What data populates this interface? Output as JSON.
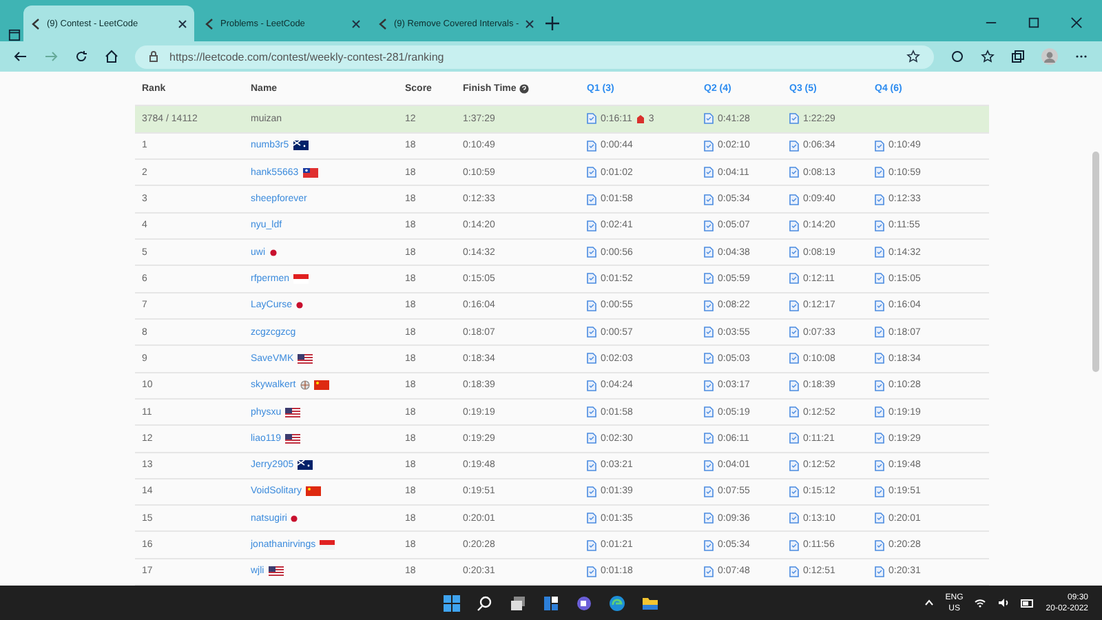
{
  "browser": {
    "tabs": [
      {
        "title": "(9) Contest - LeetCode",
        "selected": true
      },
      {
        "title": "Problems - LeetCode",
        "selected": false
      },
      {
        "title": "(9) Remove Covered Intervals -",
        "selected": false
      }
    ],
    "url": "https://leetcode.com/contest/weekly-contest-281/ranking"
  },
  "table": {
    "columns": [
      {
        "label": "Rank",
        "kind": "plain"
      },
      {
        "label": "Name",
        "kind": "plain"
      },
      {
        "label": "Score",
        "kind": "plain"
      },
      {
        "label": "Finish Time",
        "kind": "help"
      },
      {
        "label": "Q1 (3)",
        "kind": "question"
      },
      {
        "label": "Q2 (4)",
        "kind": "question"
      },
      {
        "label": "Q3 (5)",
        "kind": "question"
      },
      {
        "label": "Q4 (6)",
        "kind": "question"
      }
    ],
    "current_user": {
      "rank": "3784 / 14112",
      "name": "muizan",
      "score": "12",
      "finish": "1:37:29",
      "questions": [
        {
          "time": "0:16:11",
          "wrong": "3"
        },
        {
          "time": "0:41:28"
        },
        {
          "time": "1:22:29"
        }
      ]
    },
    "rows": [
      {
        "rank": "1",
        "name": "numb3r5",
        "flags": [
          {
            "kind": "au"
          }
        ],
        "score": "18",
        "finish": "0:10:49",
        "questions": [
          "0:00:44",
          "0:02:10",
          "0:06:34",
          "0:10:49"
        ]
      },
      {
        "rank": "2",
        "name": "hank55663",
        "flags": [
          {
            "kind": "tw"
          }
        ],
        "score": "18",
        "finish": "0:10:59",
        "questions": [
          "0:01:02",
          "0:04:11",
          "0:08:13",
          "0:10:59"
        ]
      },
      {
        "rank": "3",
        "name": "sheepforever",
        "score": "18",
        "finish": "0:12:33",
        "questions": [
          "0:01:58",
          "0:05:34",
          "0:09:40",
          "0:12:33"
        ]
      },
      {
        "rank": "4",
        "name": "nyu_ldf",
        "score": "18",
        "finish": "0:14:20",
        "questions": [
          "0:02:41",
          "0:05:07",
          "0:14:20",
          "0:11:55"
        ]
      },
      {
        "rank": "5",
        "name": "uwi",
        "flags": [
          {
            "kind": "jp"
          }
        ],
        "score": "18",
        "finish": "0:14:32",
        "questions": [
          "0:00:56",
          "0:04:38",
          "0:08:19",
          "0:14:32"
        ]
      },
      {
        "rank": "6",
        "name": "rfpermen",
        "flags": [
          {
            "kind": "id"
          }
        ],
        "score": "18",
        "finish": "0:15:05",
        "questions": [
          "0:01:52",
          "0:05:59",
          "0:12:11",
          "0:15:05"
        ]
      },
      {
        "rank": "7",
        "name": "LayCurse",
        "flags": [
          {
            "kind": "jp"
          }
        ],
        "score": "18",
        "finish": "0:16:04",
        "questions": [
          "0:00:55",
          "0:08:22",
          "0:12:17",
          "0:16:04"
        ]
      },
      {
        "rank": "8",
        "name": "zcgzcgzcg",
        "score": "18",
        "finish": "0:18:07",
        "questions": [
          "0:00:57",
          "0:03:55",
          "0:07:33",
          "0:18:07"
        ]
      },
      {
        "rank": "9",
        "name": "SaveVMK",
        "flags": [
          {
            "kind": "us"
          }
        ],
        "score": "18",
        "finish": "0:18:34",
        "questions": [
          "0:02:03",
          "0:05:03",
          "0:10:08",
          "0:18:34"
        ]
      },
      {
        "rank": "10",
        "name": "skywalkert",
        "flags": [
          {
            "kind": "badge"
          },
          {
            "kind": "cn"
          }
        ],
        "score": "18",
        "finish": "0:18:39",
        "questions": [
          "0:04:24",
          "0:03:17",
          "0:18:39",
          "0:10:28"
        ]
      },
      {
        "rank": "11",
        "name": "physxu",
        "flags": [
          {
            "kind": "us"
          }
        ],
        "score": "18",
        "finish": "0:19:19",
        "questions": [
          "0:01:58",
          "0:05:19",
          "0:12:52",
          "0:19:19"
        ]
      },
      {
        "rank": "12",
        "name": "liao119",
        "flags": [
          {
            "kind": "us"
          }
        ],
        "score": "18",
        "finish": "0:19:29",
        "questions": [
          "0:02:30",
          "0:06:11",
          "0:11:21",
          "0:19:29"
        ]
      },
      {
        "rank": "13",
        "name": "Jerry2905",
        "flags": [
          {
            "kind": "au"
          }
        ],
        "score": "18",
        "finish": "0:19:48",
        "questions": [
          "0:03:21",
          "0:04:01",
          "0:12:52",
          "0:19:48"
        ]
      },
      {
        "rank": "14",
        "name": "VoidSolitary",
        "flags": [
          {
            "kind": "cn"
          }
        ],
        "score": "18",
        "finish": "0:19:51",
        "questions": [
          "0:01:39",
          "0:07:55",
          "0:15:12",
          "0:19:51"
        ]
      },
      {
        "rank": "15",
        "name": "natsugiri",
        "flags": [
          {
            "kind": "jp"
          }
        ],
        "score": "18",
        "finish": "0:20:01",
        "questions": [
          "0:01:35",
          "0:09:36",
          "0:13:10",
          "0:20:01"
        ]
      },
      {
        "rank": "16",
        "name": "jonathanirvings",
        "flags": [
          {
            "kind": "sg"
          }
        ],
        "score": "18",
        "finish": "0:20:28",
        "questions": [
          "0:01:21",
          "0:05:34",
          "0:11:56",
          "0:20:28"
        ]
      },
      {
        "rank": "17",
        "name": "wjli",
        "flags": [
          {
            "kind": "us"
          }
        ],
        "score": "18",
        "finish": "0:20:31",
        "questions": [
          "0:01:18",
          "0:07:48",
          "0:12:51",
          "0:20:31"
        ]
      }
    ]
  },
  "taskbar": {
    "language": "ENG",
    "region": "US",
    "time": "09:30",
    "date": "20-02-2022"
  }
}
